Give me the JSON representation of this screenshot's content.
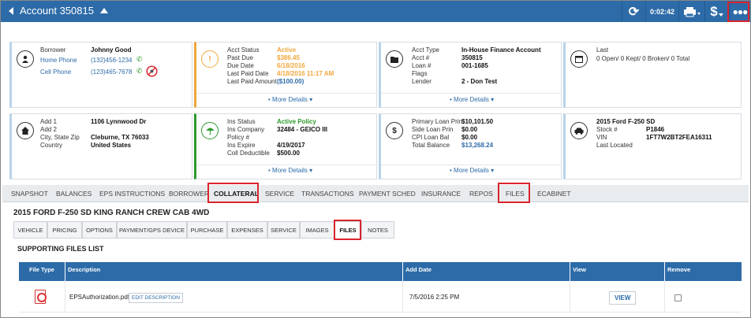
{
  "header": {
    "account_title": "Account 350815",
    "timer": "0:02:42"
  },
  "borrower_card": {
    "rows": [
      {
        "label": "Borrower",
        "value": "Johnny Good"
      },
      {
        "label": "Home Phone",
        "value": "(132)456-1234"
      },
      {
        "label": "Cell Phone",
        "value": "(123)465-7678"
      }
    ]
  },
  "account_card": {
    "rows": [
      {
        "label": "Acct Status",
        "value": "Active"
      },
      {
        "label": "Past Due",
        "value": "$386.45"
      },
      {
        "label": "Due Date",
        "value": "6/18/2016"
      },
      {
        "label": "Last Paid Date",
        "value": "4/18/2016 11:17 AM"
      },
      {
        "label": "Last Paid Amount",
        "value": "($100.00)"
      }
    ],
    "more": "More Details"
  },
  "loan_card": {
    "rows": [
      {
        "label": "Acct Type",
        "value": "In-House Finance Account"
      },
      {
        "label": "Acct #",
        "value": "350815"
      },
      {
        "label": "Loan #",
        "value": "001-1685"
      },
      {
        "label": "Flags",
        "value": ""
      },
      {
        "label": "Lender",
        "value": "2 - Don Test"
      }
    ],
    "more": "More Details"
  },
  "promise_card": {
    "label": "Last",
    "value": "0 Open/ 0 Kept/ 0 Broken/ 0 Total"
  },
  "address_card": {
    "rows": [
      {
        "label": "Add 1",
        "value": "1106 Lynnwood Dr"
      },
      {
        "label": "Add 2",
        "value": ""
      },
      {
        "label": "City, State Zip",
        "value": "Cleburne, TX 76033"
      },
      {
        "label": "Country",
        "value": "United States"
      }
    ]
  },
  "insurance_card": {
    "rows": [
      {
        "label": "Ins Status",
        "value": "Active Policy"
      },
      {
        "label": "Ins Company",
        "value": "32484 - GEICO III"
      },
      {
        "label": "Policy #",
        "value": ""
      },
      {
        "label": "Ins Expire",
        "value": "4/19/2017"
      },
      {
        "label": "Coll Deductible",
        "value": "$500.00"
      }
    ],
    "more": "More Details"
  },
  "balance_card": {
    "rows": [
      {
        "label": "Primary Loan Prin",
        "value": "$10,101.50"
      },
      {
        "label": "Side Loan Prin",
        "value": "$0.00"
      },
      {
        "label": "CPI Loan Bal",
        "value": "$0.00"
      },
      {
        "label": "Total Balance",
        "value": "$13,268.24"
      }
    ],
    "more": "More Details"
  },
  "vehicle_card": {
    "title": "2015 Ford F-250 SD",
    "rows": [
      {
        "label": "Stock #",
        "value": "P1846"
      },
      {
        "label": "VIN",
        "value": "1FT7W2BT2FEA16311"
      },
      {
        "label": "Last Located",
        "value": ""
      }
    ]
  },
  "main_tabs": [
    "SNAPSHOT",
    "BALANCES",
    "EPS INSTRUCTIONS",
    "BORROWER",
    "COLLATERAL",
    "SERVICE",
    "TRANSACTIONS",
    "PAYMENT SCHED",
    "INSURANCE",
    "REPOS",
    "FILES",
    "ECABINET"
  ],
  "vehicle_title": "2015 FORD F-250 SD KING RANCH CREW CAB 4WD",
  "sub_tabs": [
    "VEHICLE",
    "PRICING",
    "OPTIONS",
    "PAYMENT/GPS DEVICE",
    "PURCHASE",
    "EXPENSES",
    "SERVICE",
    "IMAGES",
    "FILES",
    "NOTES"
  ],
  "section_title": "SUPPORTING FILES LIST",
  "table": {
    "headers": [
      "File Type",
      "Description",
      "Add Date",
      "View",
      "Remove"
    ],
    "rows": [
      {
        "description": "EPSAuthorization.pdf",
        "edit_label": "EDIT DESCRIPTION",
        "add_date": "7/5/2016 2:25 PM",
        "view_label": "VIEW"
      }
    ]
  },
  "colors": {
    "brand": "#2d6ba8",
    "highlight": "#d9252f",
    "warning": "#f0a73c",
    "success": "#2b9a2b"
  }
}
